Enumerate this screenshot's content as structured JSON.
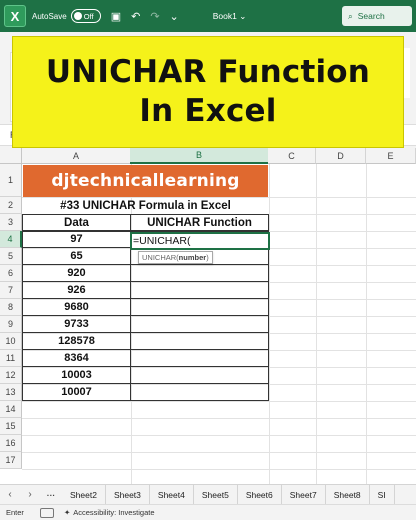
{
  "titlebar": {
    "autosave_label": "AutoSave",
    "autosave_state": "Off",
    "workbook": "Book1",
    "workbook_chevron": "⌄",
    "search_placeholder": "Search"
  },
  "ribbon": {
    "name_box_partial": "RL"
  },
  "banner": {
    "line1": "UNICHAR Function",
    "line2": "In Excel"
  },
  "columns": [
    "A",
    "B",
    "C",
    "D",
    "E"
  ],
  "selected_column": "B",
  "rows": [
    "1",
    "2",
    "3",
    "4",
    "5",
    "6",
    "7",
    "8",
    "9",
    "10",
    "11",
    "12",
    "13",
    "14",
    "15",
    "16",
    "17"
  ],
  "selected_row": "4",
  "sheet": {
    "brand": "djtechnicallearning",
    "heading": "#33 UNICHAR Formula in Excel",
    "col_a_header": "Data",
    "col_b_header": "UNICHAR Function",
    "data": [
      "97",
      "65",
      "920",
      "926",
      "9680",
      "9733",
      "128578",
      "8364",
      "10003",
      "10007"
    ],
    "editing_formula": "=UNICHAR(",
    "tooltip_fn": "UNICHAR(",
    "tooltip_arg": "number",
    "tooltip_close": ")"
  },
  "tabs": [
    "Sheet2",
    "Sheet3",
    "Sheet4",
    "Sheet5",
    "Sheet6",
    "Sheet7",
    "Sheet8",
    "SI"
  ],
  "status": {
    "mode": "Enter",
    "accessibility": "Accessibility: Investigate"
  },
  "colors": {
    "excel_green": "#1e7145",
    "banner_yellow": "#f5f21a",
    "brand_orange": "#e0692f"
  }
}
